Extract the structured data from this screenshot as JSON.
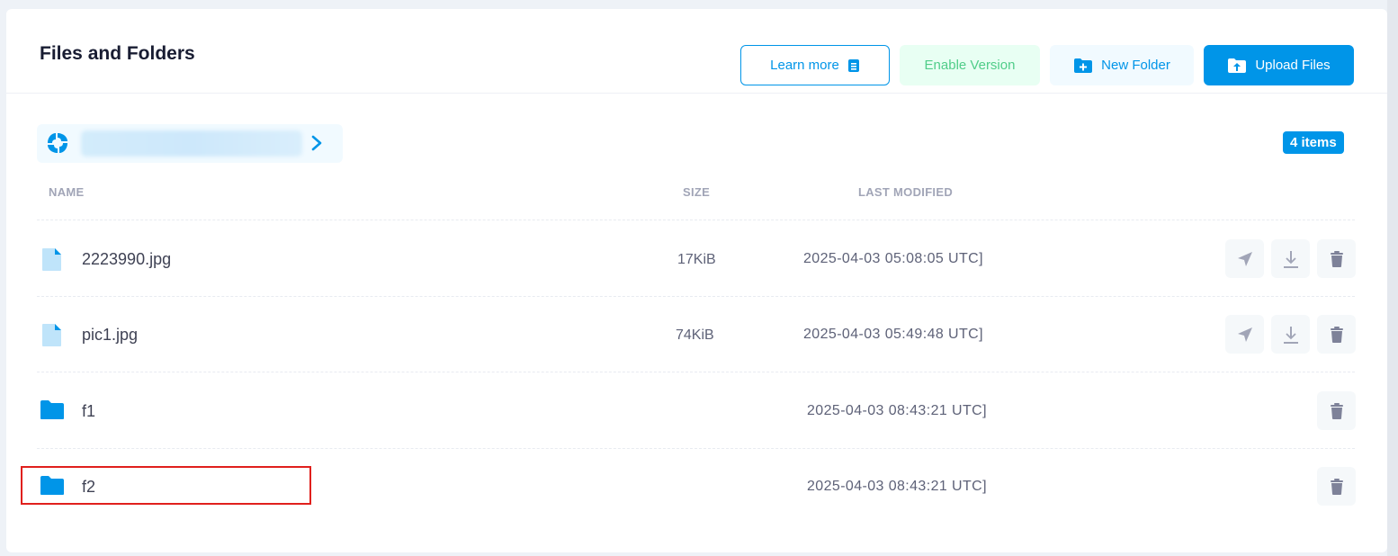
{
  "header": {
    "title": "Files and Folders",
    "learn_more_label": "Learn more",
    "enable_version_label": "Enable Version",
    "new_folder_label": "New Folder",
    "upload_files_label": "Upload Files"
  },
  "item_count": "4 items",
  "columns": {
    "name": "NAME",
    "size": "SIZE",
    "last_modified": "LAST MODIFIED"
  },
  "rows": [
    {
      "type": "file",
      "name": "2223990.jpg",
      "size": "17KiB",
      "modified": "2025-04-03 05:08:05 UTC]"
    },
    {
      "type": "file",
      "name": "pic1.jpg",
      "size": "74KiB",
      "modified": "2025-04-03 05:49:48 UTC]"
    },
    {
      "type": "folder",
      "name": "f1",
      "size": "",
      "modified": "2025-04-03 08:43:21 UTC]"
    },
    {
      "type": "folder",
      "name": "f2",
      "size": "",
      "modified": "2025-04-03 08:43:21 UTC]"
    }
  ],
  "colors": {
    "primary": "#0095e8",
    "success": "#50cd89",
    "highlight": "#e0201d"
  },
  "icons": {
    "file": "file-icon",
    "folder": "folder-icon",
    "share": "send-icon",
    "download": "download-icon",
    "delete": "trash-icon"
  }
}
